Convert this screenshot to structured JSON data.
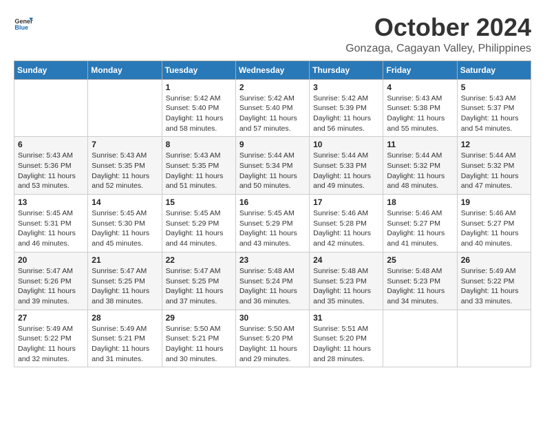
{
  "logo": {
    "general": "General",
    "blue": "Blue"
  },
  "title": "October 2024",
  "location": "Gonzaga, Cagayan Valley, Philippines",
  "days_header": [
    "Sunday",
    "Monday",
    "Tuesday",
    "Wednesday",
    "Thursday",
    "Friday",
    "Saturday"
  ],
  "weeks": [
    [
      {
        "day": "",
        "info": ""
      },
      {
        "day": "",
        "info": ""
      },
      {
        "day": "1",
        "sunrise": "5:42 AM",
        "sunset": "5:40 PM",
        "daylight": "11 hours and 58 minutes."
      },
      {
        "day": "2",
        "sunrise": "5:42 AM",
        "sunset": "5:40 PM",
        "daylight": "11 hours and 57 minutes."
      },
      {
        "day": "3",
        "sunrise": "5:42 AM",
        "sunset": "5:39 PM",
        "daylight": "11 hours and 56 minutes."
      },
      {
        "day": "4",
        "sunrise": "5:43 AM",
        "sunset": "5:38 PM",
        "daylight": "11 hours and 55 minutes."
      },
      {
        "day": "5",
        "sunrise": "5:43 AM",
        "sunset": "5:37 PM",
        "daylight": "11 hours and 54 minutes."
      }
    ],
    [
      {
        "day": "6",
        "sunrise": "5:43 AM",
        "sunset": "5:36 PM",
        "daylight": "11 hours and 53 minutes."
      },
      {
        "day": "7",
        "sunrise": "5:43 AM",
        "sunset": "5:35 PM",
        "daylight": "11 hours and 52 minutes."
      },
      {
        "day": "8",
        "sunrise": "5:43 AM",
        "sunset": "5:35 PM",
        "daylight": "11 hours and 51 minutes."
      },
      {
        "day": "9",
        "sunrise": "5:44 AM",
        "sunset": "5:34 PM",
        "daylight": "11 hours and 50 minutes."
      },
      {
        "day": "10",
        "sunrise": "5:44 AM",
        "sunset": "5:33 PM",
        "daylight": "11 hours and 49 minutes."
      },
      {
        "day": "11",
        "sunrise": "5:44 AM",
        "sunset": "5:32 PM",
        "daylight": "11 hours and 48 minutes."
      },
      {
        "day": "12",
        "sunrise": "5:44 AM",
        "sunset": "5:32 PM",
        "daylight": "11 hours and 47 minutes."
      }
    ],
    [
      {
        "day": "13",
        "sunrise": "5:45 AM",
        "sunset": "5:31 PM",
        "daylight": "11 hours and 46 minutes."
      },
      {
        "day": "14",
        "sunrise": "5:45 AM",
        "sunset": "5:30 PM",
        "daylight": "11 hours and 45 minutes."
      },
      {
        "day": "15",
        "sunrise": "5:45 AM",
        "sunset": "5:29 PM",
        "daylight": "11 hours and 44 minutes."
      },
      {
        "day": "16",
        "sunrise": "5:45 AM",
        "sunset": "5:29 PM",
        "daylight": "11 hours and 43 minutes."
      },
      {
        "day": "17",
        "sunrise": "5:46 AM",
        "sunset": "5:28 PM",
        "daylight": "11 hours and 42 minutes."
      },
      {
        "day": "18",
        "sunrise": "5:46 AM",
        "sunset": "5:27 PM",
        "daylight": "11 hours and 41 minutes."
      },
      {
        "day": "19",
        "sunrise": "5:46 AM",
        "sunset": "5:27 PM",
        "daylight": "11 hours and 40 minutes."
      }
    ],
    [
      {
        "day": "20",
        "sunrise": "5:47 AM",
        "sunset": "5:26 PM",
        "daylight": "11 hours and 39 minutes."
      },
      {
        "day": "21",
        "sunrise": "5:47 AM",
        "sunset": "5:25 PM",
        "daylight": "11 hours and 38 minutes."
      },
      {
        "day": "22",
        "sunrise": "5:47 AM",
        "sunset": "5:25 PM",
        "daylight": "11 hours and 37 minutes."
      },
      {
        "day": "23",
        "sunrise": "5:48 AM",
        "sunset": "5:24 PM",
        "daylight": "11 hours and 36 minutes."
      },
      {
        "day": "24",
        "sunrise": "5:48 AM",
        "sunset": "5:23 PM",
        "daylight": "11 hours and 35 minutes."
      },
      {
        "day": "25",
        "sunrise": "5:48 AM",
        "sunset": "5:23 PM",
        "daylight": "11 hours and 34 minutes."
      },
      {
        "day": "26",
        "sunrise": "5:49 AM",
        "sunset": "5:22 PM",
        "daylight": "11 hours and 33 minutes."
      }
    ],
    [
      {
        "day": "27",
        "sunrise": "5:49 AM",
        "sunset": "5:22 PM",
        "daylight": "11 hours and 32 minutes."
      },
      {
        "day": "28",
        "sunrise": "5:49 AM",
        "sunset": "5:21 PM",
        "daylight": "11 hours and 31 minutes."
      },
      {
        "day": "29",
        "sunrise": "5:50 AM",
        "sunset": "5:21 PM",
        "daylight": "11 hours and 30 minutes."
      },
      {
        "day": "30",
        "sunrise": "5:50 AM",
        "sunset": "5:20 PM",
        "daylight": "11 hours and 29 minutes."
      },
      {
        "day": "31",
        "sunrise": "5:51 AM",
        "sunset": "5:20 PM",
        "daylight": "11 hours and 28 minutes."
      },
      {
        "day": "",
        "info": ""
      },
      {
        "day": "",
        "info": ""
      }
    ]
  ],
  "labels": {
    "sunrise": "Sunrise:",
    "sunset": "Sunset:",
    "daylight": "Daylight:"
  }
}
